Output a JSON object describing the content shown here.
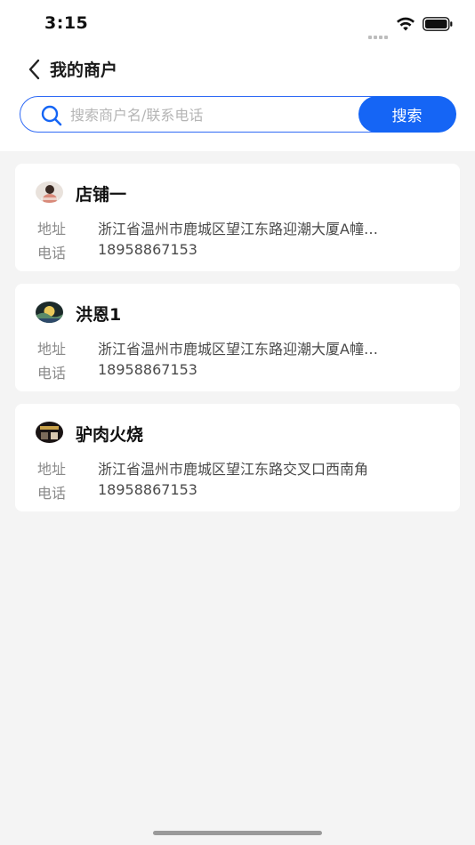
{
  "status_bar": {
    "time": "3:15",
    "icons": [
      "signal-dots-icon",
      "wifi-icon",
      "battery-icon"
    ]
  },
  "header": {
    "back_icon": "chevron-left-icon",
    "title": "我的商户"
  },
  "search": {
    "placeholder": "搜索商户名/联系电话",
    "value": "",
    "button_label": "搜索",
    "accent_color": "#1565f5",
    "border_color": "#2f6af5"
  },
  "merchants": [
    {
      "name": "店铺一",
      "avatar": "avatar-person-icon",
      "address_label": "地址",
      "address": "浙江省温州市鹿城区望江东路迎潮大厦A幢…",
      "phone_label": "电话",
      "phone": "18958867153"
    },
    {
      "name": "洪恩1",
      "avatar": "avatar-landscape-icon",
      "address_label": "地址",
      "address": "浙江省温州市鹿城区望江东路迎潮大厦A幢…",
      "phone_label": "电话",
      "phone": "18958867153"
    },
    {
      "name": "驴肉火烧",
      "avatar": "avatar-storefront-icon",
      "address_label": "地址",
      "address": "浙江省温州市鹿城区望江东路交叉口西南角",
      "phone_label": "电话",
      "phone": "18958867153"
    }
  ]
}
